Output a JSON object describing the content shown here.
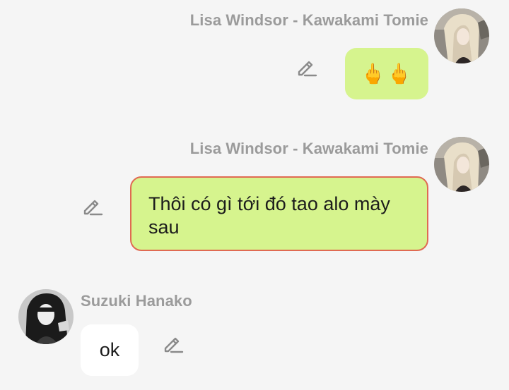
{
  "messages": [
    {
      "sender": "Lisa Windsor - Kawakami Tomie",
      "text": "🖕🖕",
      "side": "right",
      "avatar_icon": "avatar-blonde-girl"
    },
    {
      "sender": "Lisa Windsor - Kawakami Tomie",
      "text": "Thôi có gì tới đó tao alo mày sau",
      "side": "right",
      "selected": true,
      "avatar_icon": "avatar-blonde-girl"
    },
    {
      "sender": "Suzuki Hanako",
      "text": "ok",
      "side": "left",
      "avatar_icon": "avatar-dark-haired-girl"
    }
  ],
  "icons": {
    "edit": "pencil-edit-icon"
  },
  "colors": {
    "background": "#f5f5f5",
    "my_bubble": "#d6f48e",
    "their_bubble": "#ffffff",
    "selected_border": "#e06a52",
    "sender_name": "#9b9b9b"
  }
}
